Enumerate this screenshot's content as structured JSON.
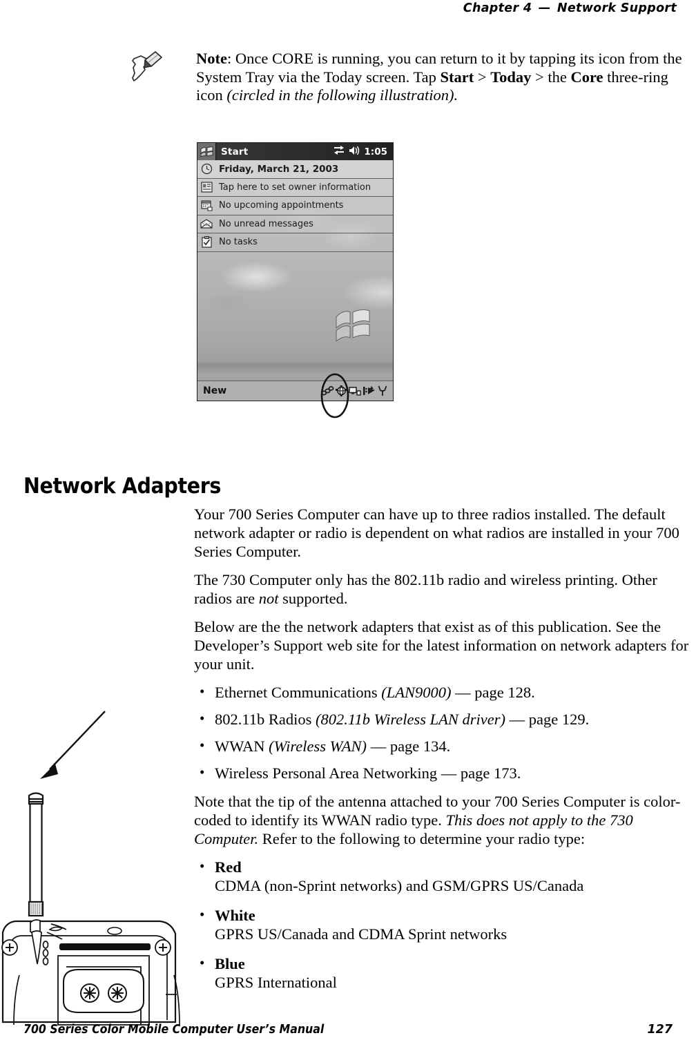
{
  "running_head": {
    "chapter_label": "Chapter",
    "chapter_number": "4",
    "dash": "—",
    "title": "Network Support"
  },
  "note": {
    "icon": "note-pencil-icon",
    "label": "Note",
    "text_part1": ": Once CORE is running, you can return to it by tapping its icon from the System Tray via the Today screen. Tap ",
    "bold_start": "Start",
    "sep1": " > ",
    "bold_today": "Today",
    "sep2": " > the ",
    "bold_core": "Core",
    "text_part2": " three-ring icon ",
    "italic_tail": "(circled in the following illustration)."
  },
  "pda_screenshot": {
    "titlebar": {
      "start_icon": "windows-flag-icon",
      "start_label": "Start",
      "connection_icon": "connectivity-icon",
      "volume_icon": "speaker-icon",
      "clock": "1:05"
    },
    "rows": [
      {
        "icon": "clock-icon",
        "label": "Friday, March 21, 2003"
      },
      {
        "icon": "owner-info-icon",
        "label": "Tap here to set owner information"
      },
      {
        "icon": "calendar-icon",
        "label": "No upcoming appointments"
      },
      {
        "icon": "envelope-icon",
        "label": "No unread messages"
      },
      {
        "icon": "tasks-icon",
        "label": "No tasks"
      }
    ],
    "taskbar": {
      "new_label": "New",
      "tray_icons": [
        "core-three-ring-icon",
        "network-globe-icon",
        "desktop-connection-icon",
        "wireless-printing-icon",
        "antenna-signal-icon"
      ]
    },
    "annotation": "hand-drawn-ellipse-around-core-icon",
    "wallpaper": "grayscale-sky-clouds-with-windows-logo"
  },
  "section": {
    "heading": "Network Adapters",
    "paragraphs": [
      "Your 700 Series Computer can have up to three radios installed. The default network adapter or radio is dependent on what radios are installed in your 700 Series Computer.",
      "Below are the the network adapters that exist as of this publication. See the Developer’s Support web site for the latest information on network adapters for your unit."
    ],
    "para_730": {
      "lead": "The 730 Computer only has the 802.11b radio and wireless printing. Other radios are ",
      "italic": "not",
      "tail": " supported."
    },
    "adapters": [
      {
        "name": "Ethernet Communications ",
        "italic": "(LAN9000)",
        "page_ref": " — page 128."
      },
      {
        "name": "802.11b Radios ",
        "italic": "(802.11b Wireless LAN driver)",
        "page_ref": " — page 129."
      },
      {
        "name": "WWAN ",
        "italic": "(Wireless WAN)",
        "page_ref": " — page 134."
      },
      {
        "name": "Wireless Personal Area Networking",
        "italic": "",
        "page_ref": " — page 173."
      }
    ],
    "antenna_note": {
      "lead": "Note that the tip of the antenna attached to your 700 Series Computer is color-coded to identify its WWAN radio type. ",
      "italic": "This does not apply to the 730 Computer.",
      "tail": " Refer to the following to determine your radio type:"
    },
    "radio_colors": [
      {
        "color_name": "Red",
        "description": "CDMA (non-Sprint networks) and GSM/GPRS US/Canada"
      },
      {
        "color_name": "White",
        "description": "GPRS US/Canada and CDMA Sprint networks"
      },
      {
        "color_name": "Blue",
        "description": "GPRS International"
      }
    ]
  },
  "figure": {
    "name": "antenna-on-device-back-line-art",
    "callout": "arrow-pointing-to-antenna-tip"
  },
  "footer": {
    "title": "700 Series Color Mobile Computer User’s Manual",
    "page_number": "127"
  }
}
